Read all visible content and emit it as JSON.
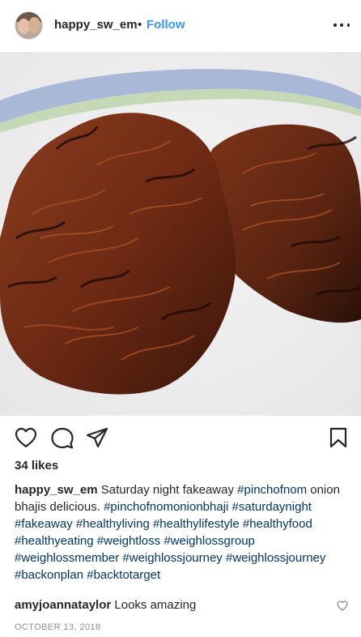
{
  "post": {
    "username": "happy_sw_em",
    "separator": "•",
    "follow_label": "Follow",
    "photo_icon": "food-photo",
    "likes": "34 likes",
    "caption": {
      "username": "happy_sw_em",
      "text_1": "Saturday night fakeaway",
      "text_2": "onion bhajis delicious.",
      "hashtags": [
        "#pinchofnom",
        "#pinchofnomonionbhaji",
        "#saturdaynight",
        "#fakeaway",
        "#healthyliving",
        "#healthylifestyle",
        "#healthyfood",
        "#healthyeating",
        "#weightloss",
        "#weighlossgroup",
        "#weighlossmember",
        "#weighlossjourney",
        "#weighlossjourney",
        "#backonplan",
        "#backtotarget"
      ]
    },
    "comment": {
      "username": "amyjoannataylor",
      "text": "Looks amazing"
    },
    "date": "OCTOBER 13, 2018"
  },
  "icons": {
    "more": "more-options-icon",
    "like": "heart-icon",
    "comment": "comment-icon",
    "share": "share-icon",
    "save": "bookmark-icon"
  },
  "colors": {
    "link": "#3897f0",
    "hashtag": "#003569",
    "text": "#262626",
    "muted": "#8e8e8e"
  }
}
